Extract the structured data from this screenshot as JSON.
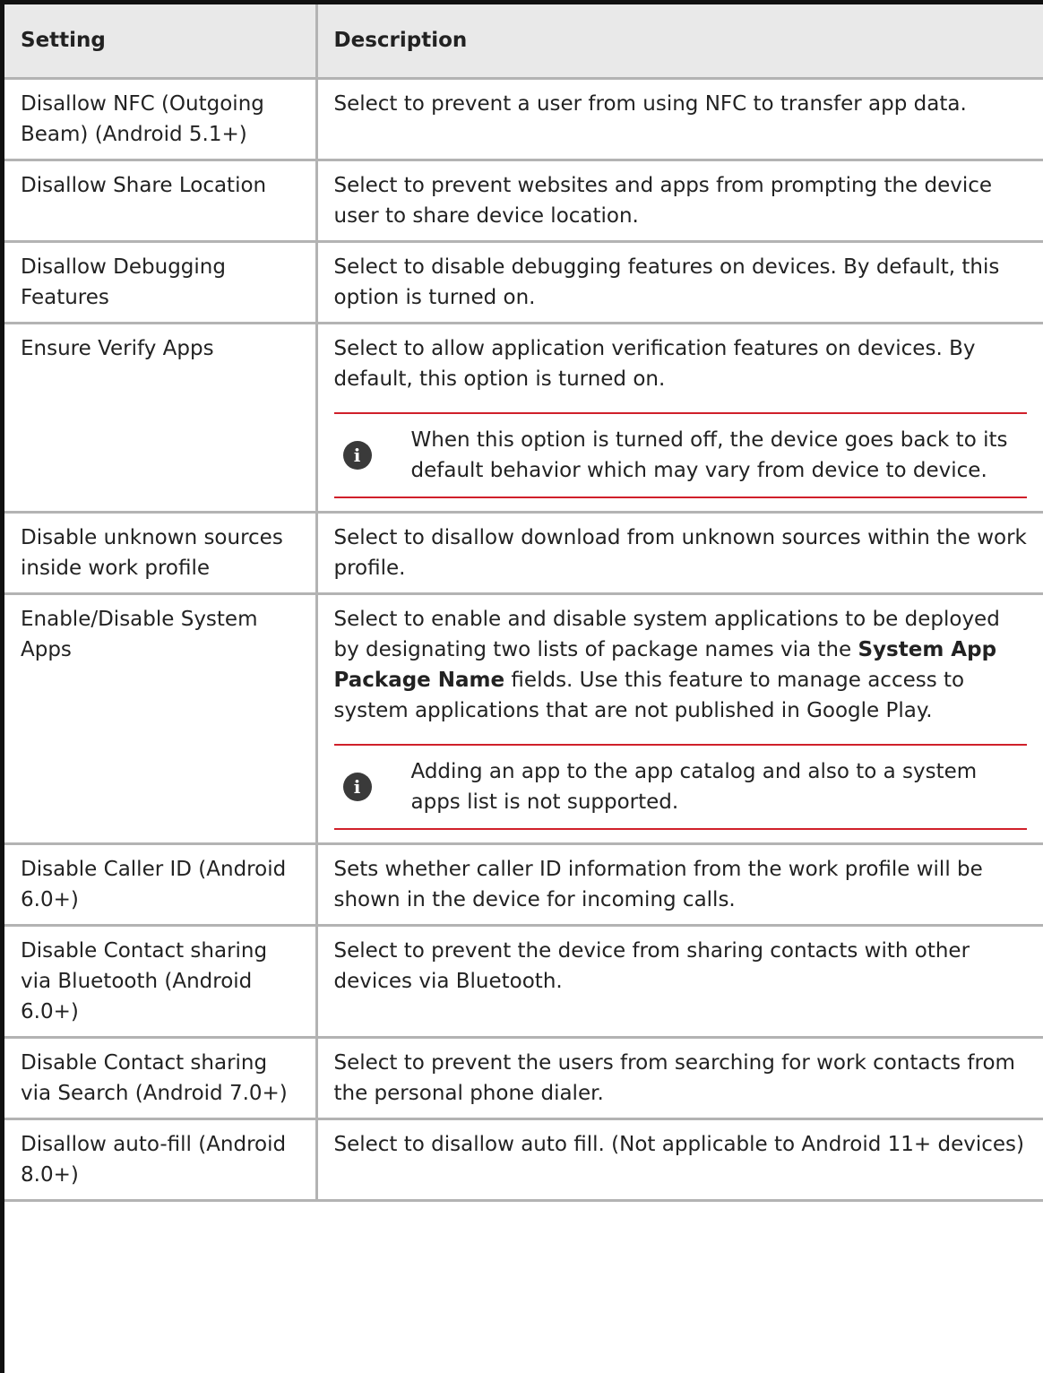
{
  "table": {
    "header": {
      "setting": "Setting",
      "description": "Description"
    },
    "rows": [
      {
        "setting": "Disallow NFC (Outgoing Beam) (Android 5.1+)",
        "description": "Select to prevent a user from using NFC to transfer app data."
      },
      {
        "setting": "Disallow Share Location",
        "description": "Select to prevent websites and apps from prompting the device user to share device location."
      },
      {
        "setting": "Disallow Debugging Features",
        "description": "Select to disable debugging features on devices. By default, this option is turned on."
      },
      {
        "setting": "Ensure Verify Apps",
        "description": "Select to allow application verification features on devices. By default, this option is turned on.",
        "note": "When this option is turned off, the device goes back to its default behavior which may vary from device to device."
      },
      {
        "setting": "Disable unknown sources inside work profile",
        "description": "Select to disallow download from unknown sources within the work profile."
      },
      {
        "setting": "Enable/Disable System Apps",
        "description_before": "Select to enable and disable system applications to be deployed by designating two lists of package names via the ",
        "description_bold": "System App Package Name",
        "description_after": " fields. Use this feature to manage access to system applications that are not published in Google Play.",
        "note": "Adding an app to the app catalog and also to a system apps list is not supported."
      },
      {
        "setting": "Disable Caller ID (Android 6.0+)",
        "description": "Sets whether caller ID information from the work profile will be shown in the device for incoming calls."
      },
      {
        "setting": "Disable Contact sharing via Bluetooth (Android 6.0+)",
        "description": "Select to prevent the device from sharing contacts with other devices via Bluetooth."
      },
      {
        "setting": "Disable Contact sharing via Search (Android 7.0+)",
        "description": "Select to prevent the users from searching for work contacts from the personal phone dialer."
      },
      {
        "setting": "Disallow auto-fill (Android 8.0+)",
        "description": "Select to disallow auto fill. (Not applicable to Android 11+ devices)"
      }
    ]
  },
  "icons": {
    "info": "info-icon",
    "info_glyph": "i"
  },
  "colors": {
    "header_background": "#e9e9e9",
    "note_rule": "#d0202a",
    "info_icon": "#3a3a3a"
  }
}
